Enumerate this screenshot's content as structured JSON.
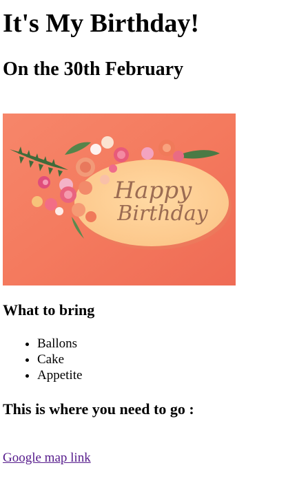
{
  "page": {
    "title": "It's My Birthday!",
    "date_heading": "On the 30th February"
  },
  "image": {
    "text_line1": "Happy",
    "text_line2": "Birthday",
    "colors": {
      "background": "#f47a5e",
      "plate": "#ffd29a",
      "lettering": "#8a5a46"
    }
  },
  "bring_section": {
    "heading": "What to bring",
    "items": [
      "Ballons",
      "Cake",
      "Appetite"
    ]
  },
  "location_section": {
    "heading": "This is where you need to go :",
    "link_text": "Google map link"
  },
  "link_color": "#551a8b"
}
